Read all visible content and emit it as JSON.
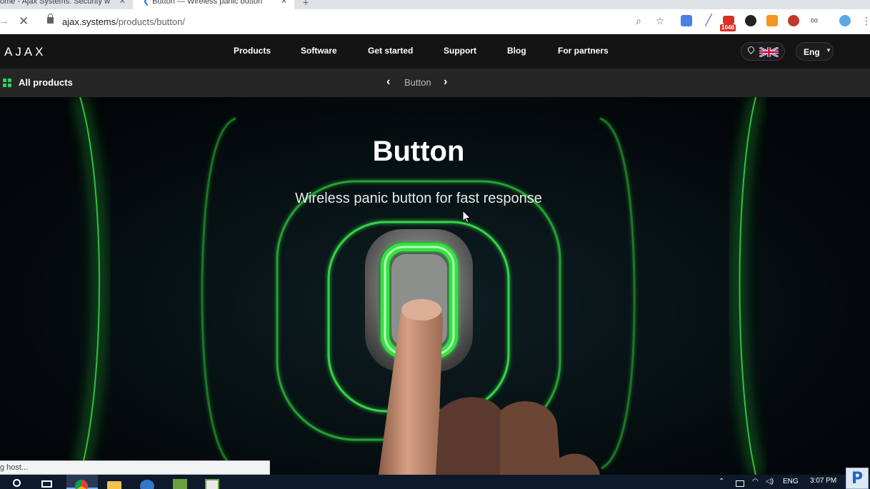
{
  "browser": {
    "tabs": [
      {
        "title": "ome - Ajax Systems: Security w"
      },
      {
        "title": "Button — Wireless panic button"
      }
    ],
    "url_host": "ajax.systems",
    "url_path": "/products/button/",
    "mail_badge": "1048"
  },
  "site": {
    "logo": "AJAX",
    "nav": [
      "Products",
      "Software",
      "Get started",
      "Support",
      "Blog",
      "For partners"
    ],
    "language": "Eng"
  },
  "subbar": {
    "all_products": "All products",
    "current_product": "Button"
  },
  "hero": {
    "title": "Button",
    "subtitle": "Wireless panic button for fast response",
    "glow_color": "#33e33f"
  },
  "status_text": "g host...",
  "taskbar": {
    "language": "ENG",
    "time": "3:07 PM"
  }
}
